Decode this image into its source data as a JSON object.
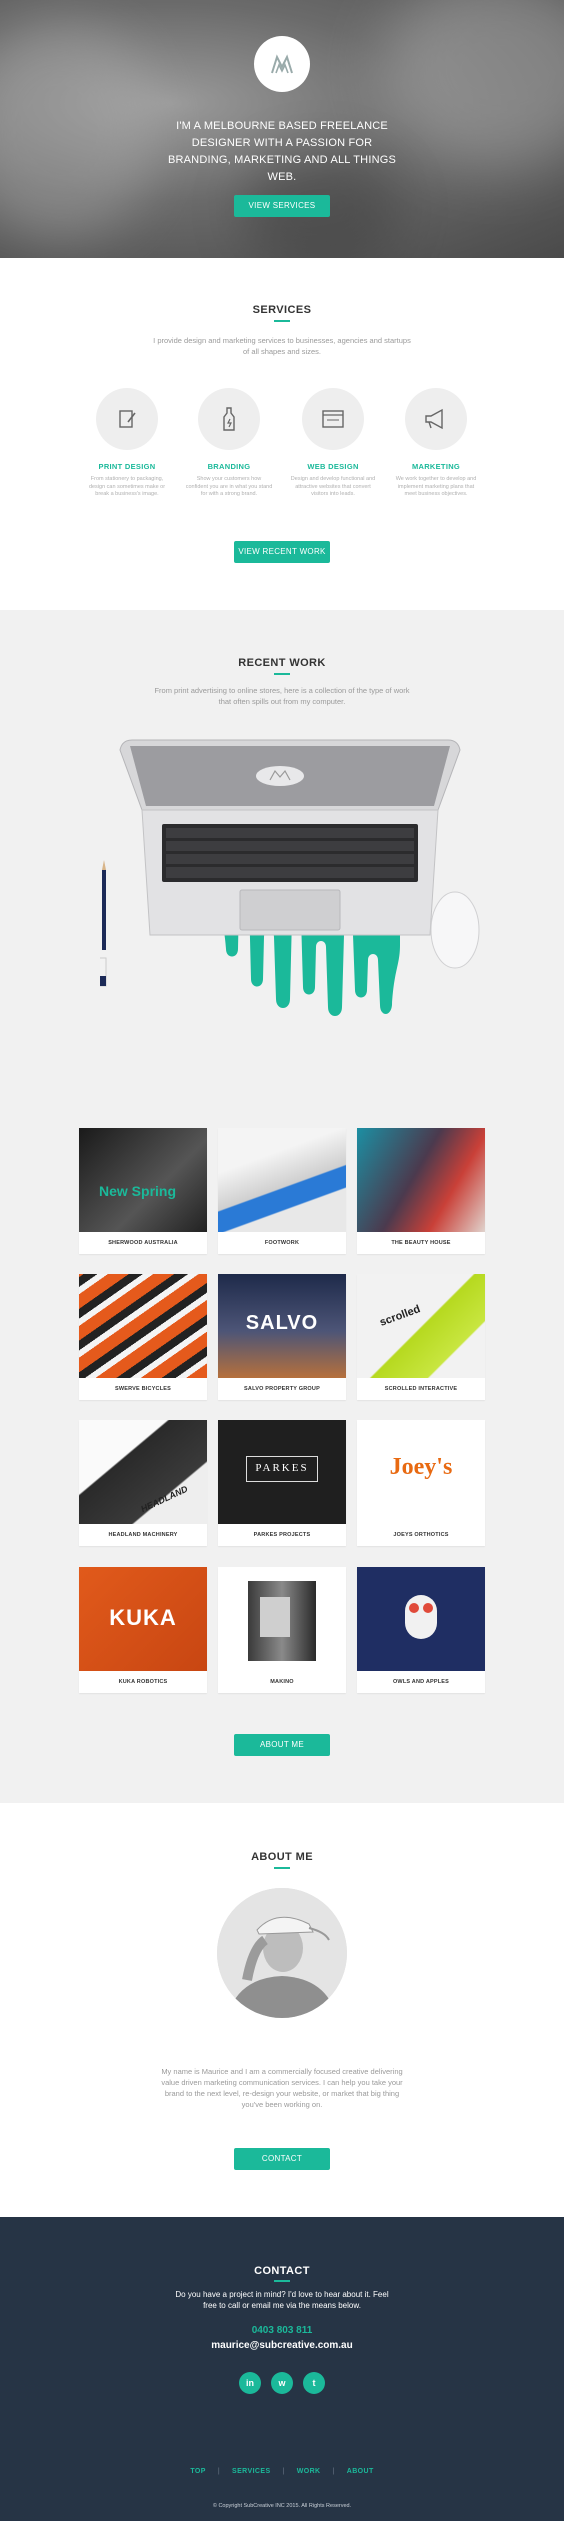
{
  "hero": {
    "tagline": "I'M A MELBOURNE BASED FREELANCE DESIGNER WITH A PASSION FOR BRANDING, MARKETING AND ALL THINGS WEB.",
    "button_label": "VIEW SERVICES"
  },
  "services": {
    "title": "SERVICES",
    "lede": "I provide design and marketing services to businesses, agencies and startups of all shapes and sizes.",
    "items": [
      {
        "title": "PRINT DESIGN",
        "desc": "From stationery to packaging, design can sometimes make or break a business's image.",
        "icon": "pencil-document-icon"
      },
      {
        "title": "BRANDING",
        "desc": "Show your customers how confident you are in what you stand for with a strong brand.",
        "icon": "bottle-icon"
      },
      {
        "title": "WEB DESIGN",
        "desc": "Design and develop functional and attractive websites that convert visitors into leads.",
        "icon": "browser-window-icon"
      },
      {
        "title": "MARKETING",
        "desc": "We work together to develop and implement marketing plans that meet business objectives.",
        "icon": "megaphone-icon"
      }
    ],
    "button_label": "VIEW RECENT WORK"
  },
  "work": {
    "title": "RECENT WORK",
    "lede": "From print advertising to online stores, here is a collection of the type of work that often spills out from my computer.",
    "items": [
      {
        "label": "SHERWOOD AUSTRALIA",
        "art": "New Spring"
      },
      {
        "label": "FOOTWORK",
        "art": ""
      },
      {
        "label": "THE BEAUTY HOUSE",
        "art": ""
      },
      {
        "label": "SWERVE BICYCLES",
        "art": ""
      },
      {
        "label": "SALVO PROPERTY GROUP",
        "art": "SALVO"
      },
      {
        "label": "SCROLLED INTERACTIVE",
        "art": "scrolled"
      },
      {
        "label": "HEADLAND MACHINERY",
        "art": "HEADLAND"
      },
      {
        "label": "PARKES PROJECTS",
        "art": "PARKES"
      },
      {
        "label": "JOEYS ORTHOTICS",
        "art": "Joey's"
      },
      {
        "label": "KUKA ROBOTICS",
        "art": "KUKA"
      },
      {
        "label": "MAKINO",
        "art": ""
      },
      {
        "label": "OWLS AND APPLES",
        "art": ""
      }
    ],
    "button_label": "ABOUT ME"
  },
  "about": {
    "title": "ABOUT ME",
    "text": "My name is Maurice and I am a commercially focused creative delivering value driven marketing communication services. I can help you take your brand to the next level, re-design your website, or market that big thing you've been working on.",
    "button_label": "CONTACT"
  },
  "contact": {
    "title": "CONTACT",
    "lede": "Do you have a project in mind? I'd love to hear about it. Feel free to call or email me via the means below.",
    "phone": "0403 803 811",
    "email": "maurice@subcreative.com.au",
    "social": [
      {
        "name": "linkedin-icon",
        "glyph": "in"
      },
      {
        "name": "vimeo-icon",
        "glyph": "w"
      },
      {
        "name": "twitter-icon",
        "glyph": "t"
      }
    ]
  },
  "footer": {
    "nav": [
      "TOP",
      "SERVICES",
      "WORK",
      "ABOUT"
    ],
    "copyright": "© Copyright SubCreative INC 2015. All Rights Reserved."
  },
  "colors": {
    "accent": "#1bb99a",
    "contact_bg": "#263445",
    "work_bg": "#f1f1f1"
  }
}
